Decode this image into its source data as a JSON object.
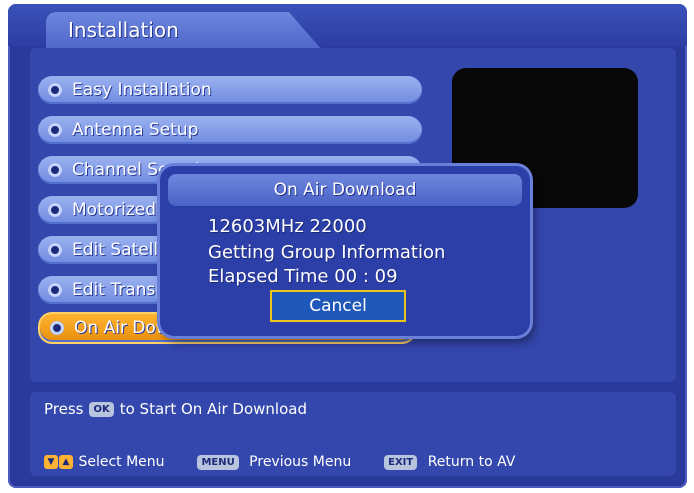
{
  "window": {
    "title": "Installation"
  },
  "menu": {
    "items": [
      {
        "label": "Easy Installation"
      },
      {
        "label": "Antenna Setup"
      },
      {
        "label": "Channel Search"
      },
      {
        "label": "Motorized"
      },
      {
        "label": "Edit Satellite"
      },
      {
        "label": "Edit Transponder"
      },
      {
        "label": "On Air Download",
        "selected": true
      }
    ]
  },
  "dialog": {
    "title": "On Air Download",
    "freq": "12603MHz 22000",
    "status": "Getting Group Information",
    "elapsed_label": "Elapsed Time",
    "elapsed_value": "00 : 09",
    "cancel_label": "Cancel"
  },
  "help": {
    "press": "Press",
    "ok_key": "OK",
    "instruction": "to Start On Air Download"
  },
  "nav": {
    "select_menu": "Select Menu",
    "menu_key": "MENU",
    "previous_menu": "Previous Menu",
    "exit_key": "EXIT",
    "return_av": "Return to AV"
  },
  "colors": {
    "background": "#2a3a9a",
    "menu_item": "#8aa3eb",
    "selected_item": "#f5a623",
    "cancel_border": "#f0c21a"
  }
}
